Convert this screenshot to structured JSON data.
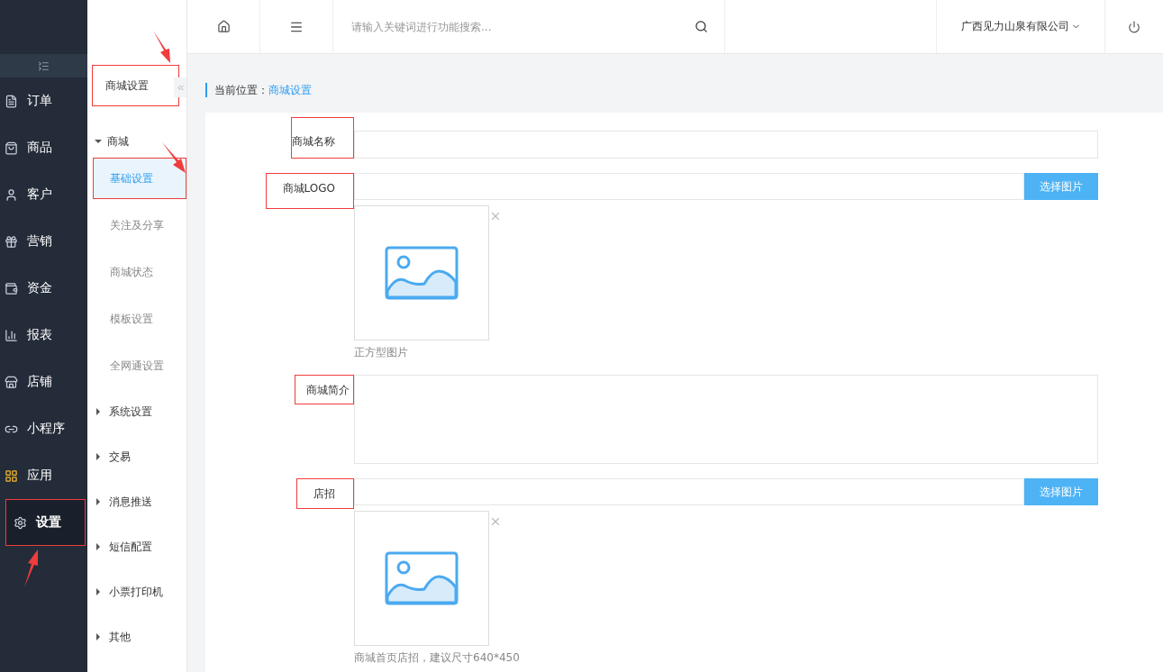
{
  "sidebar": {
    "items": [
      {
        "label": "订单",
        "selected": false,
        "annotated": false
      },
      {
        "label": "商品",
        "selected": false,
        "annotated": false
      },
      {
        "label": "客户",
        "selected": false,
        "annotated": false
      },
      {
        "label": "营销",
        "selected": false,
        "annotated": false
      },
      {
        "label": "资金",
        "selected": false,
        "annotated": false
      },
      {
        "label": "报表",
        "selected": false,
        "annotated": false
      },
      {
        "label": "店铺",
        "selected": false,
        "annotated": false
      },
      {
        "label": "小程序",
        "selected": false,
        "annotated": false
      },
      {
        "label": "应用",
        "selected": false,
        "annotated": false
      },
      {
        "label": "设置",
        "selected": true,
        "annotated": true
      }
    ]
  },
  "submenu": {
    "title": "商城设置",
    "title_annotated": true,
    "groups": [
      {
        "label": "商城",
        "expanded": true,
        "children": [
          {
            "label": "基础设置",
            "selected": true,
            "annotated": true
          },
          {
            "label": "关注及分享",
            "selected": false,
            "annotated": false
          },
          {
            "label": "商城状态",
            "selected": false,
            "annotated": false
          },
          {
            "label": "模板设置",
            "selected": false,
            "annotated": false
          },
          {
            "label": "全网通设置",
            "selected": false,
            "annotated": false
          }
        ]
      },
      {
        "label": "系统设置",
        "expanded": false
      },
      {
        "label": "交易",
        "expanded": false
      },
      {
        "label": "消息推送",
        "expanded": false
      },
      {
        "label": "短信配置",
        "expanded": false
      },
      {
        "label": "小票打印机",
        "expanded": false
      },
      {
        "label": "其他",
        "expanded": false
      }
    ]
  },
  "header": {
    "search": {
      "placeholder": "请输入关键词进行功能搜索..."
    },
    "company": "广西见力山泉有限公司"
  },
  "breadcrumb": {
    "label": "当前位置：",
    "current": "商城设置"
  },
  "form": {
    "fields": [
      {
        "kind": "text",
        "label": "商城名称",
        "annotated": true
      },
      {
        "kind": "image",
        "label": "商城LOGO",
        "annotated": true,
        "button": "选择图片",
        "hint": "正方型图片"
      },
      {
        "kind": "textarea",
        "label": "商城简介",
        "annotated": true
      },
      {
        "kind": "image",
        "label": "店招",
        "annotated": true,
        "button": "选择图片",
        "hint": "商城首页店招，建议尺寸640*450"
      }
    ]
  }
}
